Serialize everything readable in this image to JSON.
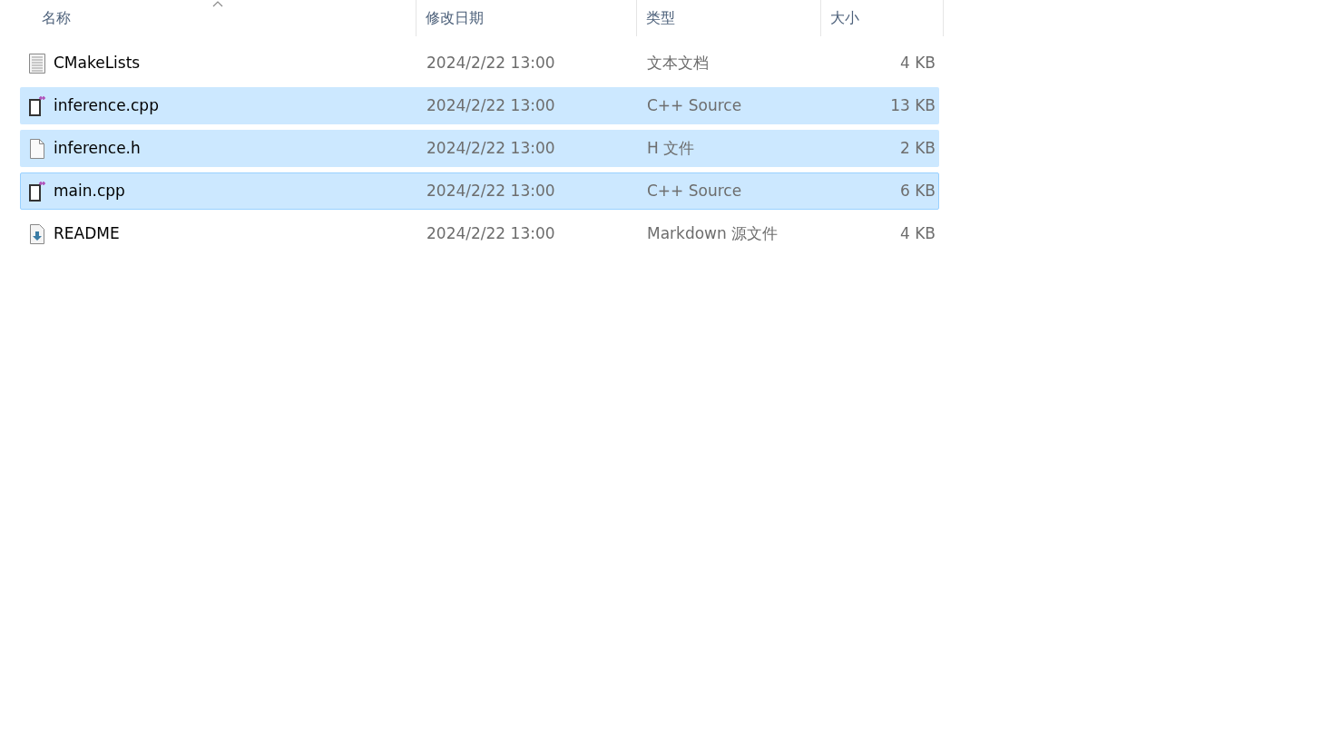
{
  "columns": [
    {
      "label": "名称",
      "sorted": true
    },
    {
      "label": "修改日期",
      "sorted": false
    },
    {
      "label": "类型",
      "sorted": false
    },
    {
      "label": "大小",
      "sorted": false
    }
  ],
  "files": [
    {
      "name": "CMakeLists",
      "kind": "text",
      "modified": "2024/2/22 13:00",
      "type": "文本文档",
      "size": "4 KB",
      "selected": false,
      "focused": false
    },
    {
      "name": "inference.cpp",
      "kind": "cpp",
      "modified": "2024/2/22 13:00",
      "type": "C++ Source",
      "size": "13 KB",
      "selected": true,
      "focused": false
    },
    {
      "name": "inference.h",
      "kind": "blank",
      "modified": "2024/2/22 13:00",
      "type": "H 文件",
      "size": "2 KB",
      "selected": true,
      "focused": false
    },
    {
      "name": "main.cpp",
      "kind": "cpp",
      "modified": "2024/2/22 13:00",
      "type": "C++ Source",
      "size": "6 KB",
      "selected": true,
      "focused": true
    },
    {
      "name": "README",
      "kind": "markdown",
      "modified": "2024/2/22 13:00",
      "type": "Markdown 源文件",
      "size": "4 KB",
      "selected": false,
      "focused": false
    }
  ]
}
